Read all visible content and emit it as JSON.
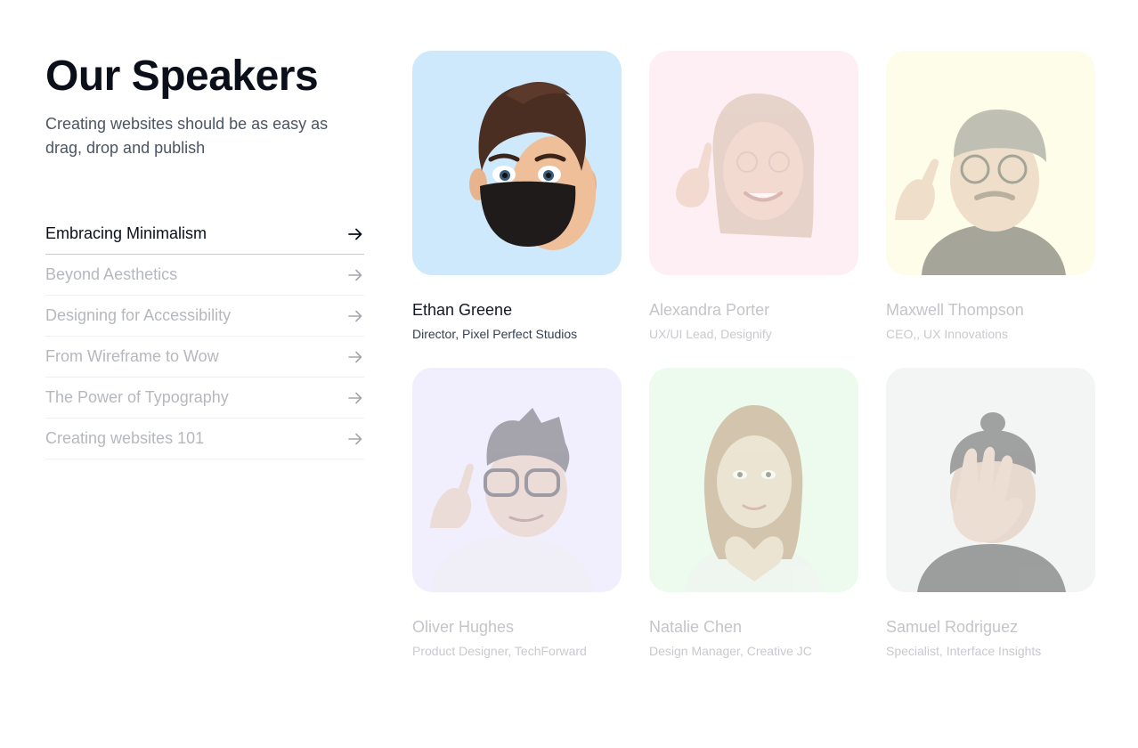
{
  "header": {
    "title": "Our Speakers",
    "subtitle": "Creating websites should be as easy as drag, drop and publish"
  },
  "topics": [
    {
      "label": "Embracing Minimalism",
      "active": true
    },
    {
      "label": "Beyond Aesthetics",
      "active": false
    },
    {
      "label": "Designing for Accessibility",
      "active": false
    },
    {
      "label": "From Wireframe to Wow",
      "active": false
    },
    {
      "label": "The Power of Typography",
      "active": false
    },
    {
      "label": "Creating websites 101",
      "active": false
    }
  ],
  "speakers": [
    {
      "name": "Ethan Greene",
      "role": "Director, Pixel Perfect Studios",
      "bg": "#cde9fb",
      "active": true
    },
    {
      "name": "Alexandra Porter",
      "role": "UX/UI Lead, Designify",
      "bg": "#fdeff3",
      "active": false
    },
    {
      "name": "Maxwell Thompson",
      "role": "CEO,, UX Innovations",
      "bg": "#fefdea",
      "active": false
    },
    {
      "name": "Oliver Hughes",
      "role": "Product Designer, TechForward",
      "bg": "#f1effd",
      "active": false
    },
    {
      "name": "Natalie Chen",
      "role": "Design Manager, Creative JC",
      "bg": "#edfaee",
      "active": false
    },
    {
      "name": "Samuel Rodriguez",
      "role": "Specialist, Interface Insights",
      "bg": "#f3f4f4",
      "active": false
    }
  ],
  "icons": {
    "topic_arrow": "arrow-right-icon",
    "avatar": "memoji-avatar"
  }
}
